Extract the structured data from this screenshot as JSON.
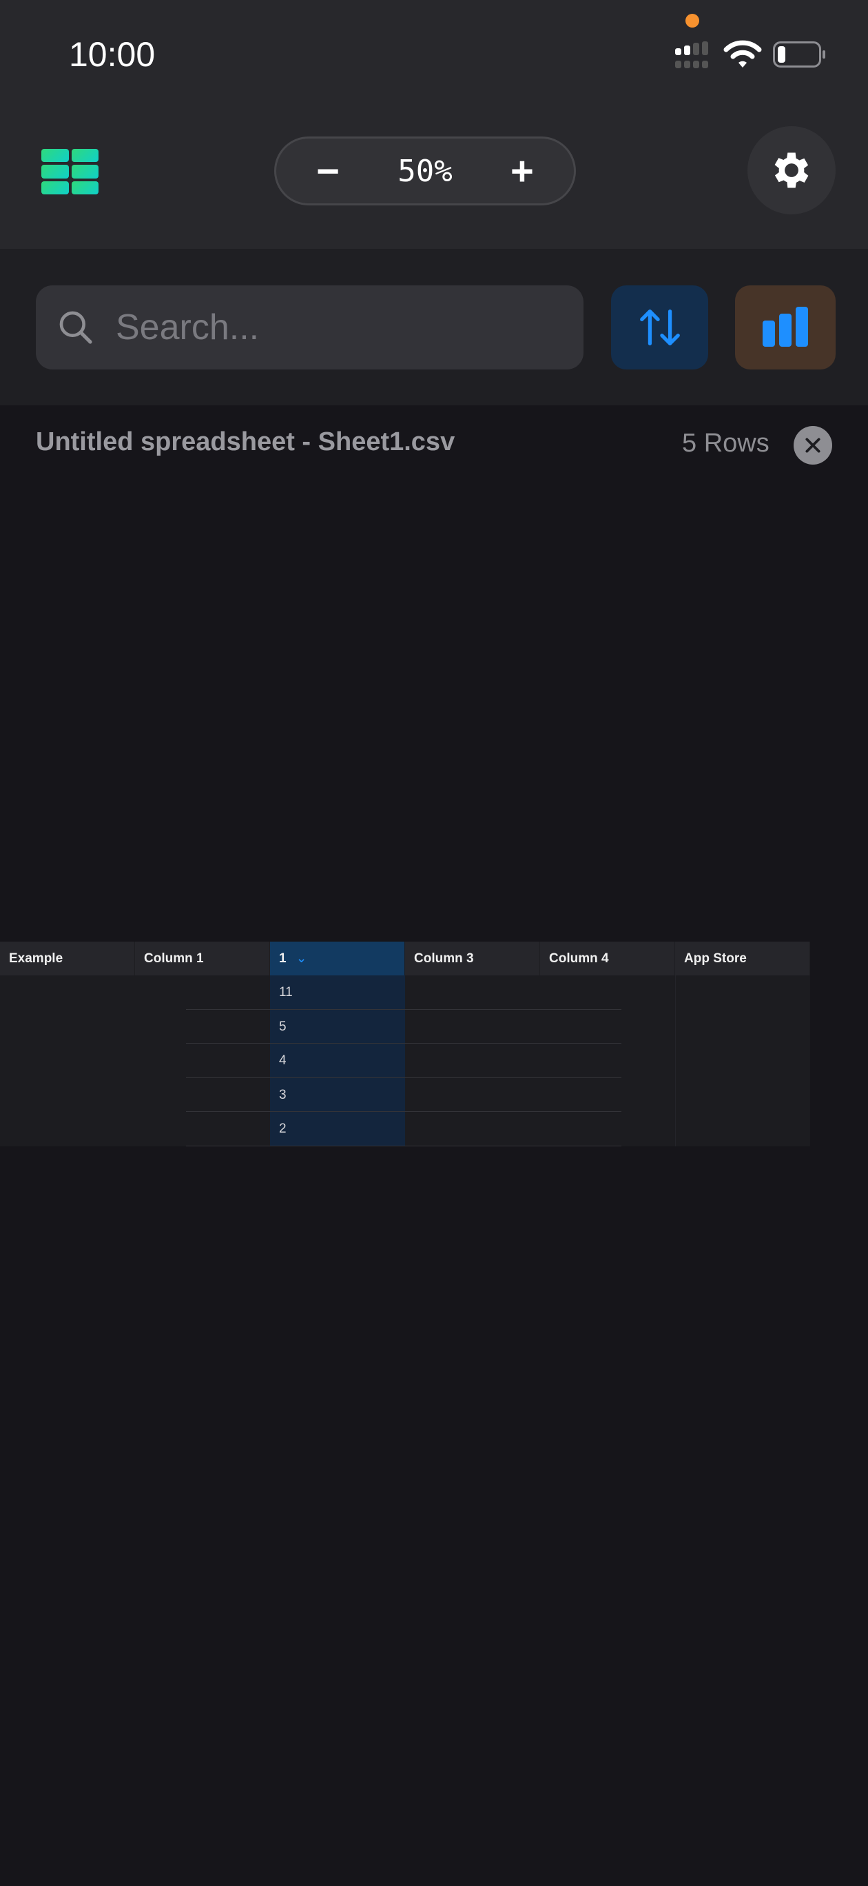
{
  "status_bar": {
    "time": "10:00"
  },
  "toolbar": {
    "zoom_value": "50%",
    "zoom_out": "−",
    "zoom_in": "+"
  },
  "search": {
    "placeholder": "Search..."
  },
  "file": {
    "title": "Untitled spreadsheet - Sheet1.csv",
    "row_count": "5 Rows"
  },
  "table": {
    "headers": [
      "Example",
      "Column 1",
      "1",
      "Column 3",
      "Column 4",
      "App Store"
    ],
    "sorted_column_values": [
      "11",
      "5",
      "4",
      "3",
      "2"
    ]
  }
}
